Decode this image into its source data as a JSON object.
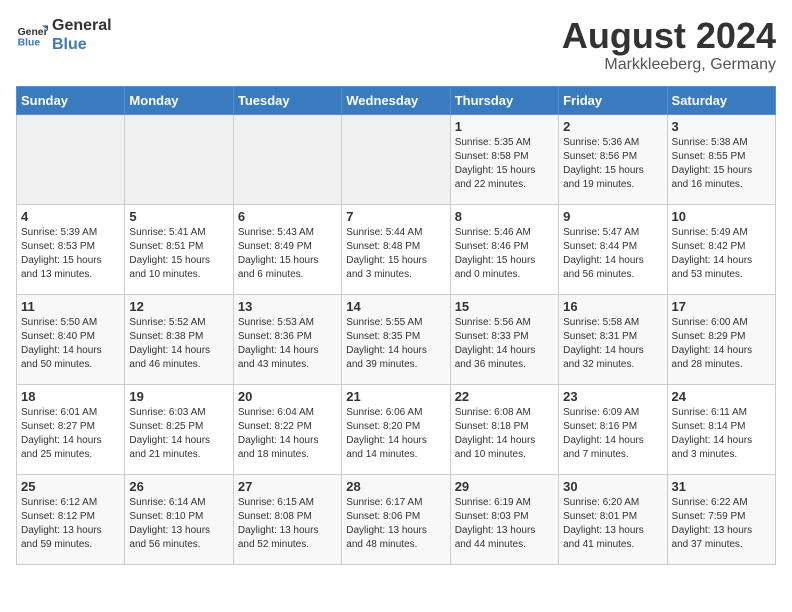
{
  "logo": {
    "line1": "General",
    "line2": "Blue"
  },
  "title": "August 2024",
  "location": "Markkleeberg, Germany",
  "days_of_week": [
    "Sunday",
    "Monday",
    "Tuesday",
    "Wednesday",
    "Thursday",
    "Friday",
    "Saturday"
  ],
  "weeks": [
    [
      {
        "day": "",
        "info": ""
      },
      {
        "day": "",
        "info": ""
      },
      {
        "day": "",
        "info": ""
      },
      {
        "day": "",
        "info": ""
      },
      {
        "day": "1",
        "info": "Sunrise: 5:35 AM\nSunset: 8:58 PM\nDaylight: 15 hours\nand 22 minutes."
      },
      {
        "day": "2",
        "info": "Sunrise: 5:36 AM\nSunset: 8:56 PM\nDaylight: 15 hours\nand 19 minutes."
      },
      {
        "day": "3",
        "info": "Sunrise: 5:38 AM\nSunset: 8:55 PM\nDaylight: 15 hours\nand 16 minutes."
      }
    ],
    [
      {
        "day": "4",
        "info": "Sunrise: 5:39 AM\nSunset: 8:53 PM\nDaylight: 15 hours\nand 13 minutes."
      },
      {
        "day": "5",
        "info": "Sunrise: 5:41 AM\nSunset: 8:51 PM\nDaylight: 15 hours\nand 10 minutes."
      },
      {
        "day": "6",
        "info": "Sunrise: 5:43 AM\nSunset: 8:49 PM\nDaylight: 15 hours\nand 6 minutes."
      },
      {
        "day": "7",
        "info": "Sunrise: 5:44 AM\nSunset: 8:48 PM\nDaylight: 15 hours\nand 3 minutes."
      },
      {
        "day": "8",
        "info": "Sunrise: 5:46 AM\nSunset: 8:46 PM\nDaylight: 15 hours\nand 0 minutes."
      },
      {
        "day": "9",
        "info": "Sunrise: 5:47 AM\nSunset: 8:44 PM\nDaylight: 14 hours\nand 56 minutes."
      },
      {
        "day": "10",
        "info": "Sunrise: 5:49 AM\nSunset: 8:42 PM\nDaylight: 14 hours\nand 53 minutes."
      }
    ],
    [
      {
        "day": "11",
        "info": "Sunrise: 5:50 AM\nSunset: 8:40 PM\nDaylight: 14 hours\nand 50 minutes."
      },
      {
        "day": "12",
        "info": "Sunrise: 5:52 AM\nSunset: 8:38 PM\nDaylight: 14 hours\nand 46 minutes."
      },
      {
        "day": "13",
        "info": "Sunrise: 5:53 AM\nSunset: 8:36 PM\nDaylight: 14 hours\nand 43 minutes."
      },
      {
        "day": "14",
        "info": "Sunrise: 5:55 AM\nSunset: 8:35 PM\nDaylight: 14 hours\nand 39 minutes."
      },
      {
        "day": "15",
        "info": "Sunrise: 5:56 AM\nSunset: 8:33 PM\nDaylight: 14 hours\nand 36 minutes."
      },
      {
        "day": "16",
        "info": "Sunrise: 5:58 AM\nSunset: 8:31 PM\nDaylight: 14 hours\nand 32 minutes."
      },
      {
        "day": "17",
        "info": "Sunrise: 6:00 AM\nSunset: 8:29 PM\nDaylight: 14 hours\nand 28 minutes."
      }
    ],
    [
      {
        "day": "18",
        "info": "Sunrise: 6:01 AM\nSunset: 8:27 PM\nDaylight: 14 hours\nand 25 minutes."
      },
      {
        "day": "19",
        "info": "Sunrise: 6:03 AM\nSunset: 8:25 PM\nDaylight: 14 hours\nand 21 minutes."
      },
      {
        "day": "20",
        "info": "Sunrise: 6:04 AM\nSunset: 8:22 PM\nDaylight: 14 hours\nand 18 minutes."
      },
      {
        "day": "21",
        "info": "Sunrise: 6:06 AM\nSunset: 8:20 PM\nDaylight: 14 hours\nand 14 minutes."
      },
      {
        "day": "22",
        "info": "Sunrise: 6:08 AM\nSunset: 8:18 PM\nDaylight: 14 hours\nand 10 minutes."
      },
      {
        "day": "23",
        "info": "Sunrise: 6:09 AM\nSunset: 8:16 PM\nDaylight: 14 hours\nand 7 minutes."
      },
      {
        "day": "24",
        "info": "Sunrise: 6:11 AM\nSunset: 8:14 PM\nDaylight: 14 hours\nand 3 minutes."
      }
    ],
    [
      {
        "day": "25",
        "info": "Sunrise: 6:12 AM\nSunset: 8:12 PM\nDaylight: 13 hours\nand 59 minutes."
      },
      {
        "day": "26",
        "info": "Sunrise: 6:14 AM\nSunset: 8:10 PM\nDaylight: 13 hours\nand 56 minutes."
      },
      {
        "day": "27",
        "info": "Sunrise: 6:15 AM\nSunset: 8:08 PM\nDaylight: 13 hours\nand 52 minutes."
      },
      {
        "day": "28",
        "info": "Sunrise: 6:17 AM\nSunset: 8:06 PM\nDaylight: 13 hours\nand 48 minutes."
      },
      {
        "day": "29",
        "info": "Sunrise: 6:19 AM\nSunset: 8:03 PM\nDaylight: 13 hours\nand 44 minutes."
      },
      {
        "day": "30",
        "info": "Sunrise: 6:20 AM\nSunset: 8:01 PM\nDaylight: 13 hours\nand 41 minutes."
      },
      {
        "day": "31",
        "info": "Sunrise: 6:22 AM\nSunset: 7:59 PM\nDaylight: 13 hours\nand 37 minutes."
      }
    ]
  ]
}
